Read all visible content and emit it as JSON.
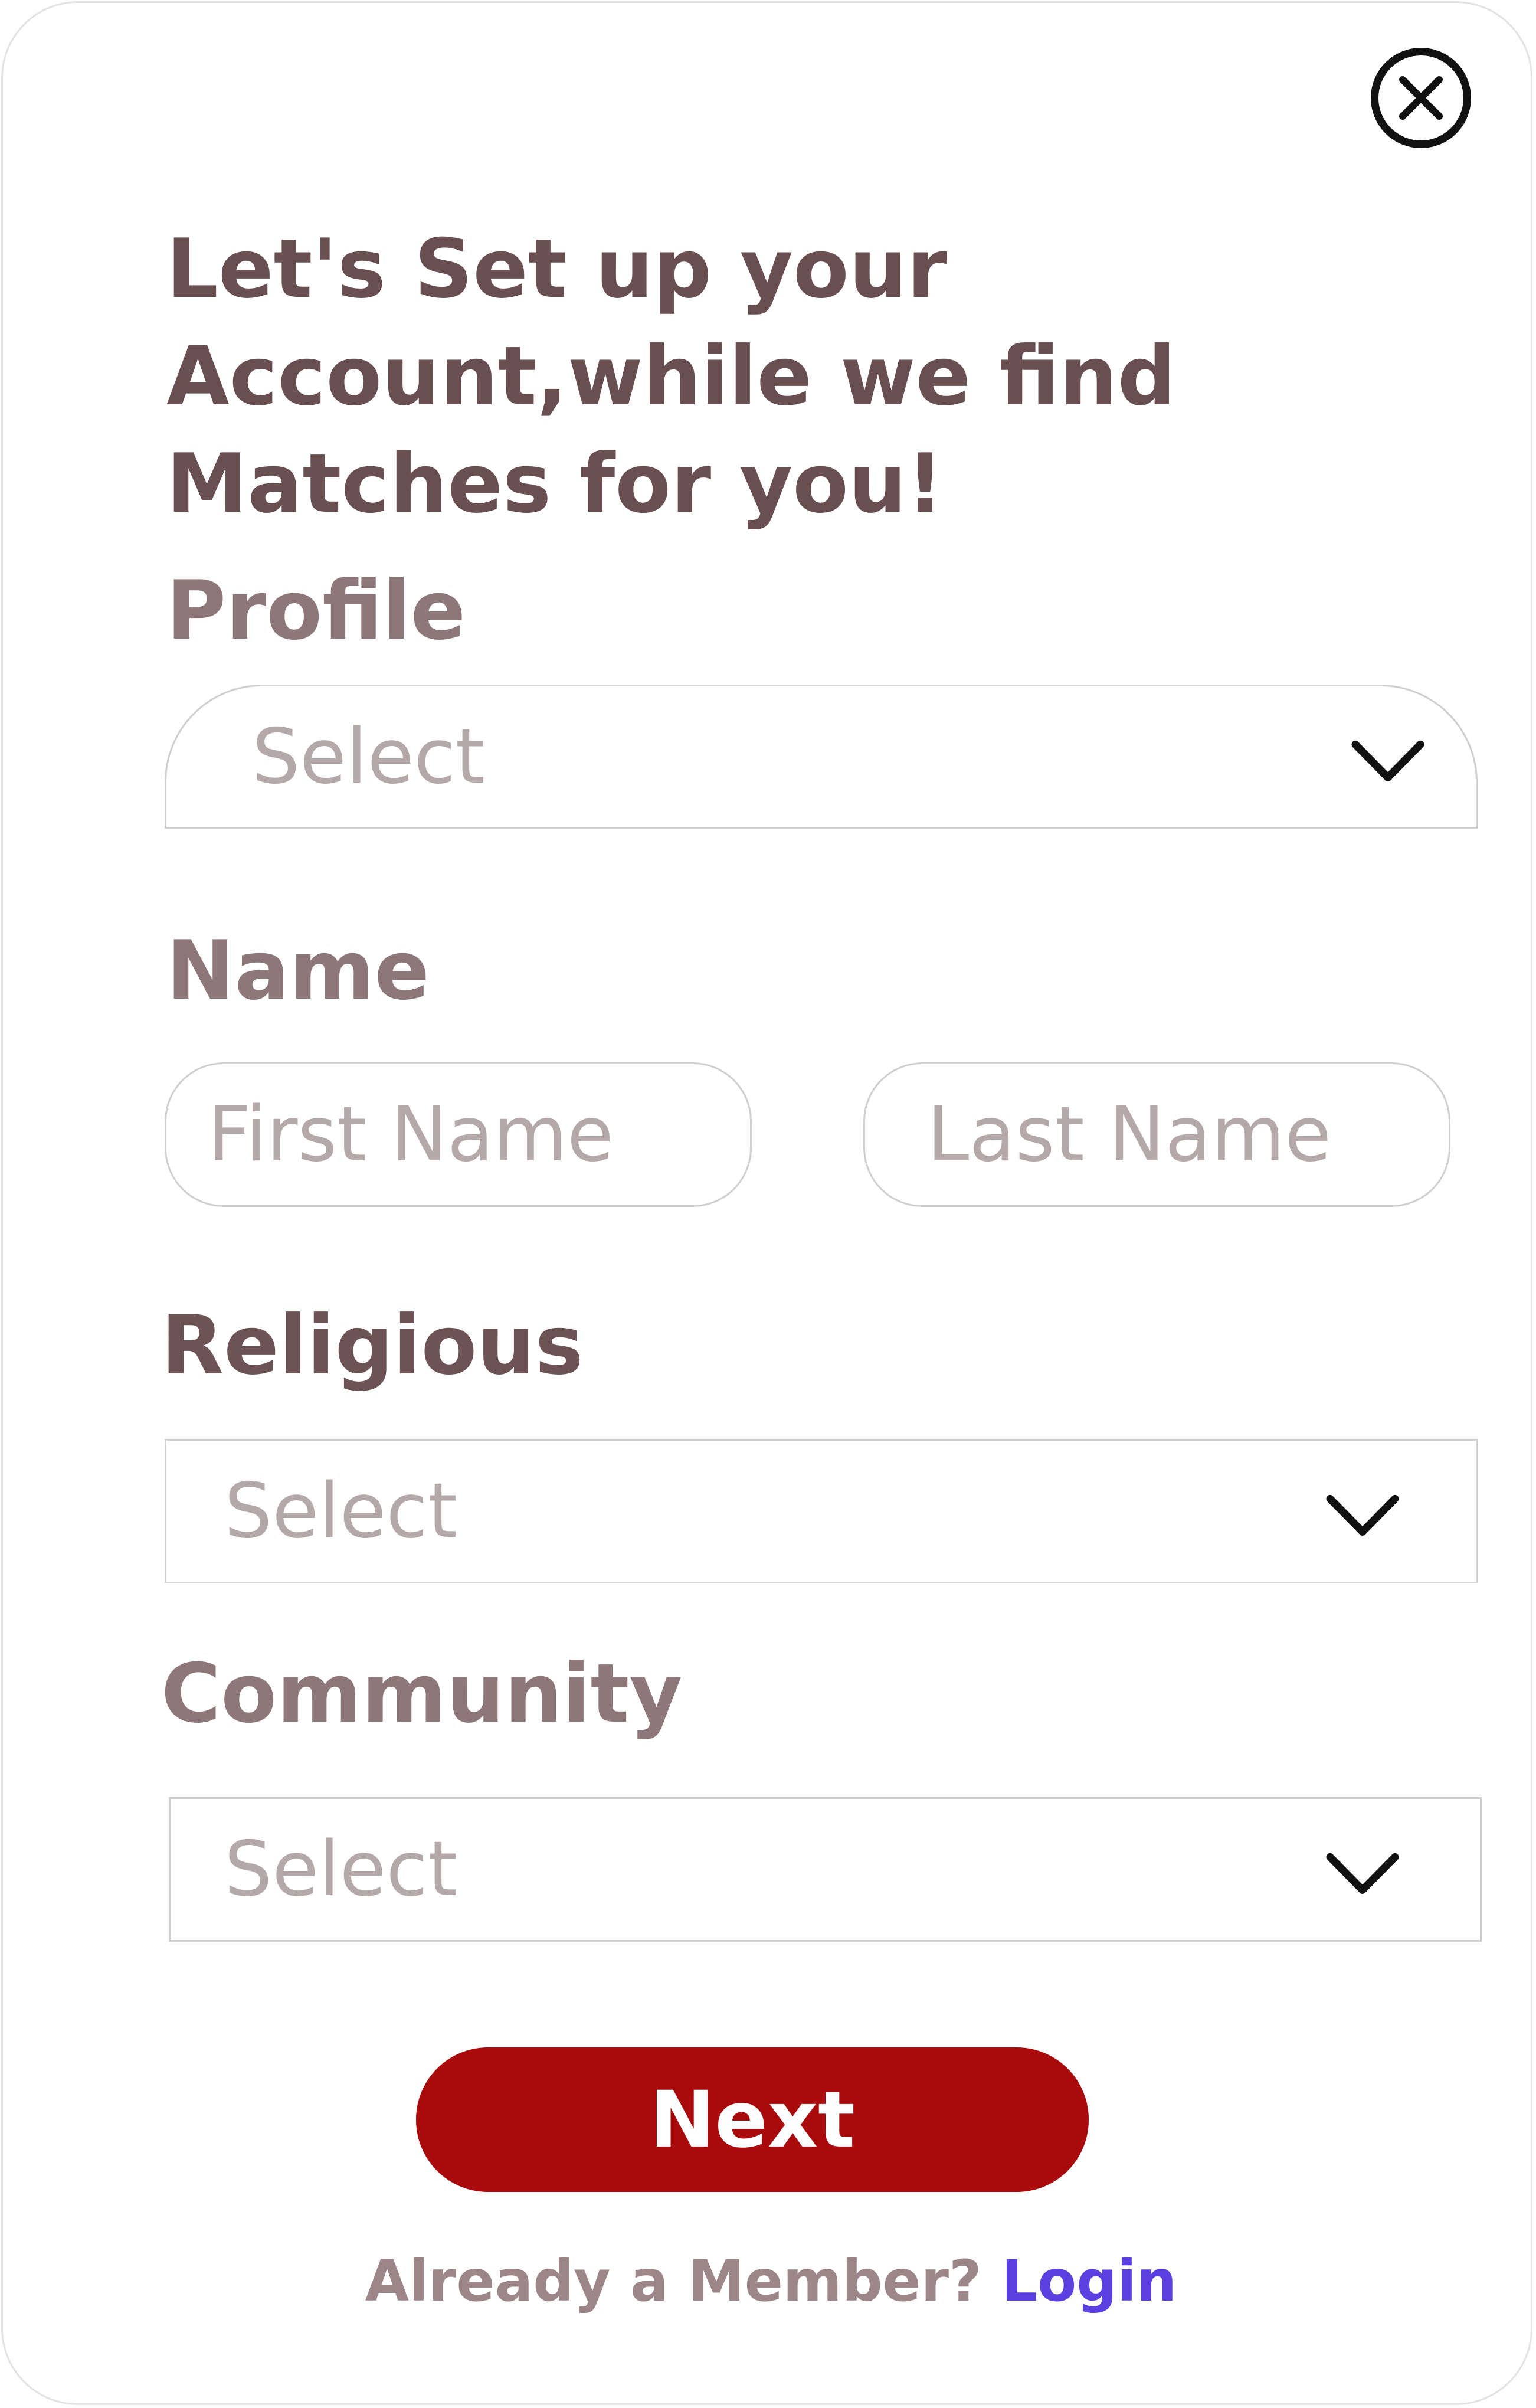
{
  "dialog": {
    "close_icon": "close-circle-icon",
    "heading": "Let's Set up your Account,while we find Matches for you!"
  },
  "profile": {
    "label": "Profile",
    "select_placeholder": "Select",
    "icon": "chevron-down-icon"
  },
  "name": {
    "label": "Name",
    "first_placeholder": "First Name",
    "last_placeholder": "Last Name"
  },
  "religious": {
    "label": "Religious",
    "select_placeholder": "Select",
    "icon": "chevron-down-icon"
  },
  "community": {
    "label": "Community",
    "select_placeholder": "Select",
    "icon": "chevron-down-icon"
  },
  "actions": {
    "next_label": "Next",
    "already_member_text": "Already a Member?",
    "login_label": "Login"
  },
  "colors": {
    "primary_button": "#a90a0c",
    "link": "#5b3fe0",
    "heading_text": "#6a4f51",
    "placeholder_text": "#b5a8a9"
  }
}
